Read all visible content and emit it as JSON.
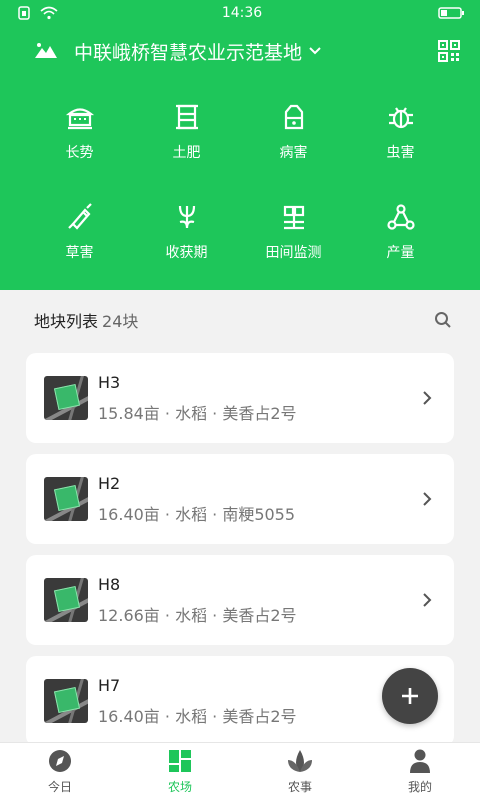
{
  "colors": {
    "brand": "#1ec65a",
    "fab": "#444444",
    "tab_active": "#1ec65a",
    "tab_inactive": "#555555"
  },
  "status": {
    "time": "14:36"
  },
  "header": {
    "title": "中联峨桥智慧农业示范基地"
  },
  "menu": [
    {
      "label": "长势",
      "icon": "growth-icon"
    },
    {
      "label": "土肥",
      "icon": "soil-icon"
    },
    {
      "label": "病害",
      "icon": "disease-icon"
    },
    {
      "label": "虫害",
      "icon": "pest-icon"
    },
    {
      "label": "草害",
      "icon": "weed-icon"
    },
    {
      "label": "收获期",
      "icon": "harvest-icon"
    },
    {
      "label": "田间监测",
      "icon": "field-monitor-icon"
    },
    {
      "label": "产量",
      "icon": "yield-icon"
    }
  ],
  "plots": {
    "title": "地块列表",
    "count": "24块",
    "items": [
      {
        "name": "H3",
        "meta": "15.84亩 · 水稻 · 美香占2号"
      },
      {
        "name": "H2",
        "meta": "16.40亩 · 水稻 · 南粳5055"
      },
      {
        "name": "H8",
        "meta": "12.66亩 · 水稻 · 美香占2号"
      },
      {
        "name": "H7",
        "meta": "16.40亩 · 水稻 · 美香占2号"
      }
    ]
  },
  "tabs": [
    {
      "label": "今日",
      "icon": "compass-icon",
      "active": false
    },
    {
      "label": "农场",
      "icon": "farm-grid-icon",
      "active": true
    },
    {
      "label": "农事",
      "icon": "sprout-icon",
      "active": false
    },
    {
      "label": "我的",
      "icon": "person-icon",
      "active": false
    }
  ]
}
